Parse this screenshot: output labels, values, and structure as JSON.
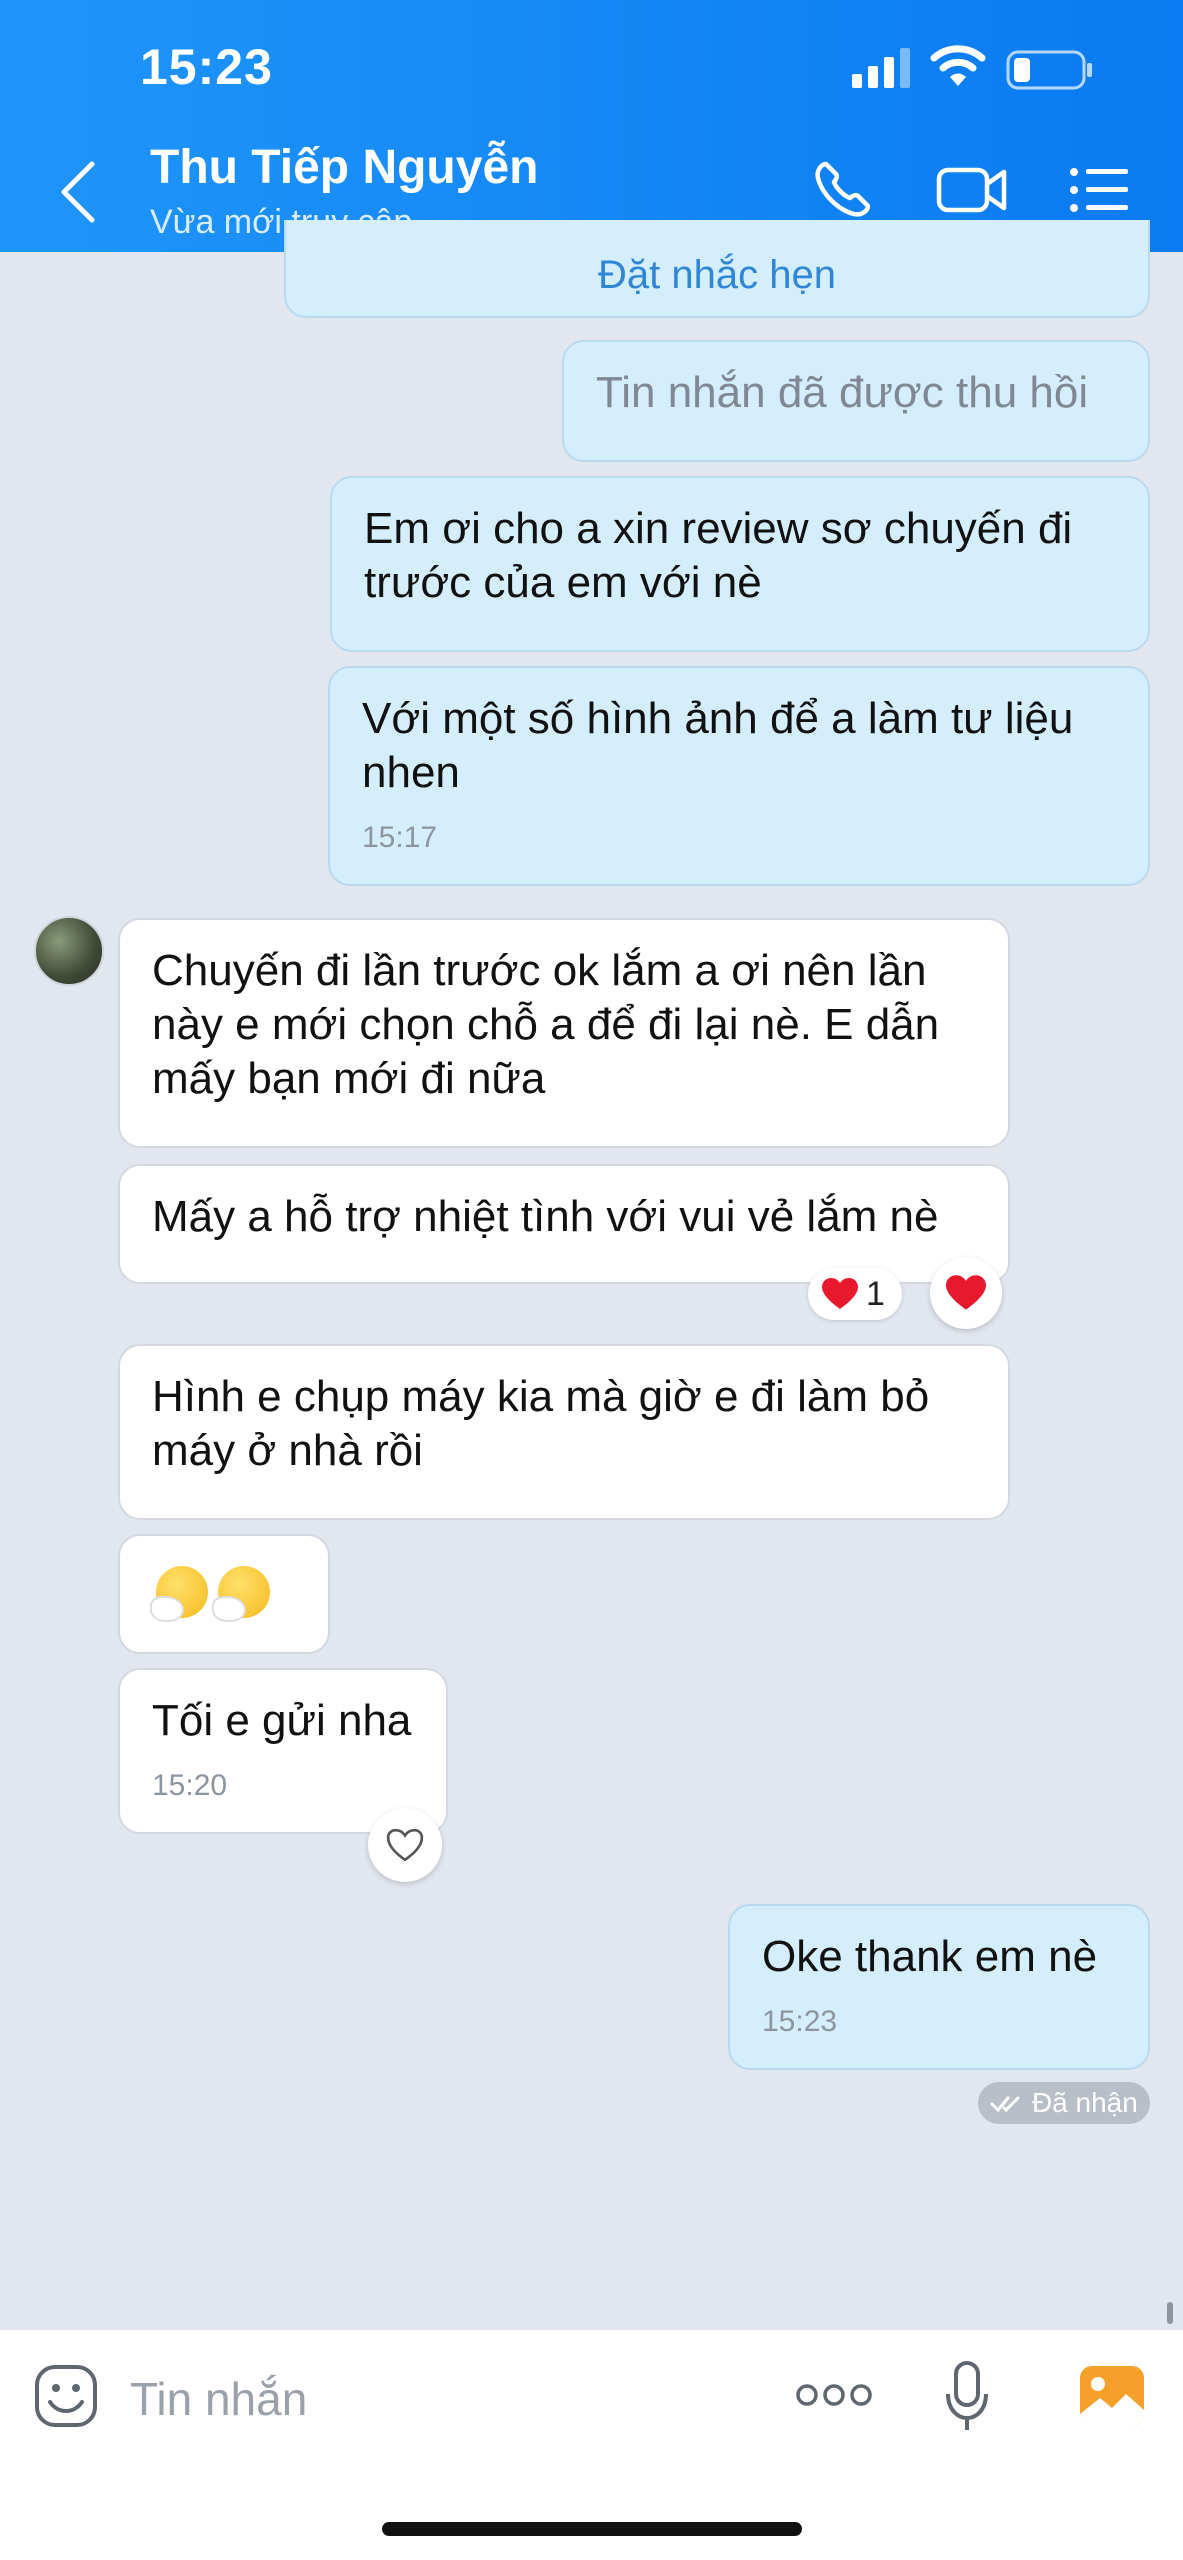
{
  "status_bar": {
    "time": "15:23"
  },
  "header": {
    "contact_name": "Thu Tiếp Nguyễn",
    "contact_status": "Vừa mới truy cập"
  },
  "messages": {
    "reminder": "Đặt nhắc hẹn",
    "recalled": "Tin nhắn đã được thu hồi",
    "out1": "Em ơi cho a xin review sơ chuyến đi trước của em với nè",
    "out2": "Với một số hình ảnh để a làm tư liệu nhen",
    "out2_time": "15:17",
    "in1": "Chuyến đi lần trước ok lắm a ơi nên lần này e mới chọn chỗ a để đi lại nè. E dẫn mấy bạn mới đi nữa",
    "in2": "Mấy a hỗ trợ nhiệt tình với vui vẻ lắm nè",
    "in2_reaction_count": "1",
    "in3": "Hình e chụp máy kia mà giờ e đi làm bỏ máy ở nhà rồi",
    "in5": "Tối e gửi nha",
    "in5_time": "15:20",
    "out3": "Oke thank em nè",
    "out3_time": "15:23",
    "received_status": "Đã nhận"
  },
  "composer": {
    "placeholder": "Tin nhắn"
  },
  "colors": {
    "header": "#0a7bf0",
    "outgoing": "#d5eefd",
    "incoming": "#ffffff",
    "background": "#e2e6ee"
  }
}
